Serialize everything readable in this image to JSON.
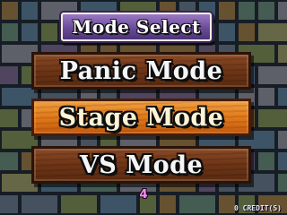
{
  "title": "Mode Select",
  "menu": {
    "items": [
      {
        "label": "Panic Mode",
        "selected": false
      },
      {
        "label": "Stage Mode",
        "selected": true
      },
      {
        "label": "VS  Mode",
        "selected": false
      }
    ]
  },
  "timer": "4",
  "credits": "0 CREDIT(S)",
  "colors": {
    "title_plate": "#6a4b98",
    "button_wood": "#6e3516",
    "button_selected": "#e07a1a",
    "timer_text": "#ff8cff",
    "tile_palette": [
      "#7d7f8a",
      "#5c6b7a",
      "#6f7f4a",
      "#8a6b3c",
      "#4f6f86",
      "#6a5a7a",
      "#8a8a5a",
      "#5a7a6a"
    ]
  }
}
